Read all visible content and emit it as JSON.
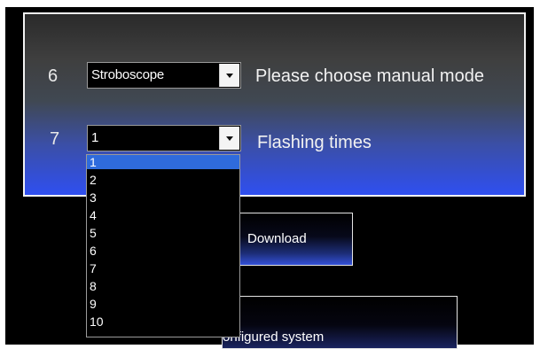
{
  "rows": [
    {
      "number": "6",
      "combo_value": "Stroboscope",
      "label": "Please choose manual mode"
    },
    {
      "number": "7",
      "combo_value": "1",
      "label": "Flashing times"
    }
  ],
  "dropdown": {
    "selected": "1",
    "options": [
      "1",
      "2",
      "3",
      "4",
      "5",
      "6",
      "7",
      "8",
      "9",
      "10"
    ]
  },
  "buttons": {
    "download_label": "Download",
    "configured_label": "onfigured system"
  },
  "colors": {
    "panel_top": "#2a2a2a",
    "panel_bottom": "#2f4ff0",
    "selection": "#2f6bdc"
  },
  "icons": {
    "combo_arrow": "chevron-down-icon"
  }
}
